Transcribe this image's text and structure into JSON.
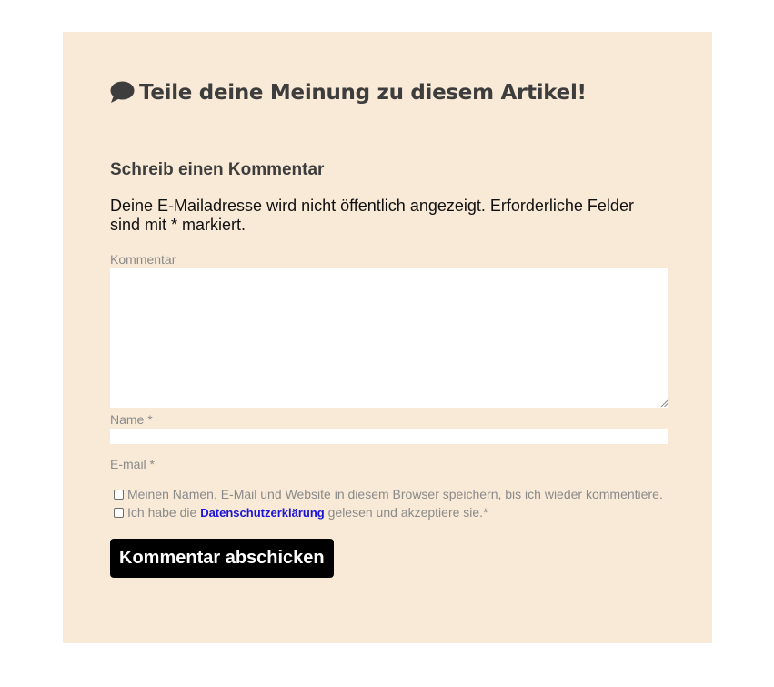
{
  "section": {
    "heading": "Teile deine Meinung zu diesem Artikel!",
    "heading_icon": "speech-bubble-icon",
    "background_color": "#f9ead7"
  },
  "form": {
    "title": "Schreib einen Kommentar",
    "notice": "Deine E-Mailadresse wird nicht öffentlich angezeigt. Erforderliche Felder sind mit * markiert.",
    "comment_label": "Kommentar",
    "comment_value": "",
    "name_label": "Name *",
    "name_value": "",
    "email_label": "E-mail *",
    "save_consent": {
      "label": "Meinen Namen, E-Mail und Website in diesem Browser speichern, bis ich wieder kommentiere.",
      "checked": false
    },
    "privacy_consent": {
      "prefix": "Ich habe die",
      "link_text": "Datenschutzerklärung",
      "suffix": "gelesen und akzeptiere sie.*",
      "checked": false,
      "link_color": "#1a12d6"
    },
    "submit_label": "Kommentar abschicken"
  }
}
